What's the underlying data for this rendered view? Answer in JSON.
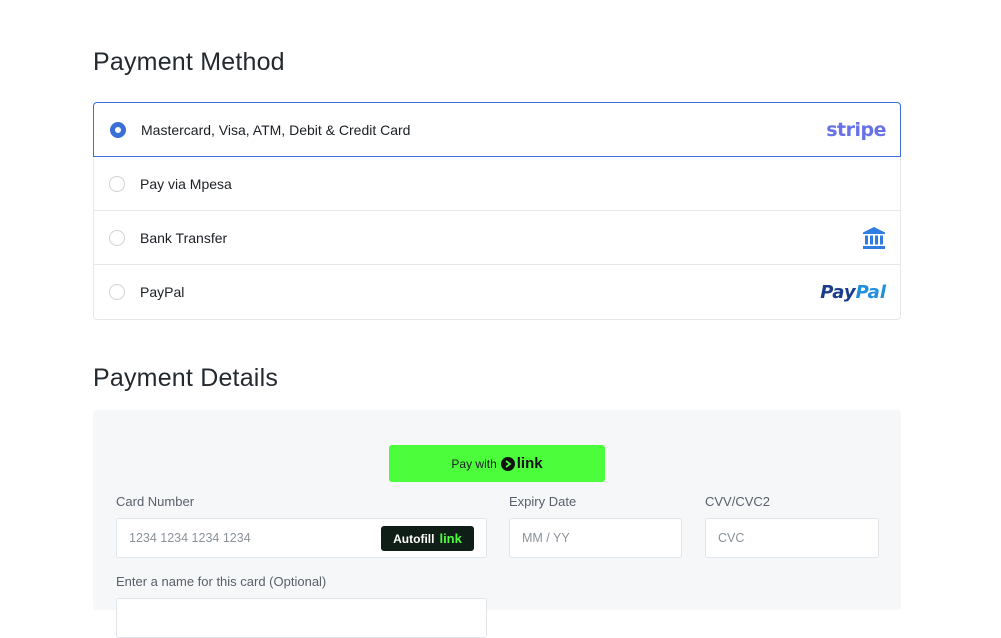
{
  "payment_method": {
    "title": "Payment Method",
    "options": [
      {
        "label": "Mastercard, Visa, ATM, Debit & Credit Card",
        "selected": true,
        "logo": "stripe"
      },
      {
        "label": "Pay via Mpesa",
        "selected": false,
        "logo": ""
      },
      {
        "label": "Bank Transfer",
        "selected": false,
        "logo": "bank-icon"
      },
      {
        "label": "PayPal",
        "selected": false,
        "logo": "paypal"
      }
    ],
    "stripe_text": "stripe",
    "paypal_text_1": "Pay",
    "paypal_text_2": "Pal"
  },
  "payment_details": {
    "title": "Payment Details",
    "link_button": {
      "prefix": "Pay with",
      "brand": "link"
    },
    "card_number": {
      "label": "Card Number",
      "placeholder": "1234 1234 1234 1234",
      "autofill": "Autofill",
      "autofill_brand": "link"
    },
    "expiry": {
      "label": "Expiry Date",
      "placeholder": "MM / YY"
    },
    "cvc": {
      "label": "CVV/CVC2",
      "placeholder": "CVC"
    },
    "card_name": {
      "label": "Enter a name for this card (Optional)"
    }
  },
  "colors": {
    "accent": "#3a6fd8",
    "link_green": "#4cfd3b",
    "stripe": "#6872e6",
    "bank_icon": "#2f7de1"
  }
}
